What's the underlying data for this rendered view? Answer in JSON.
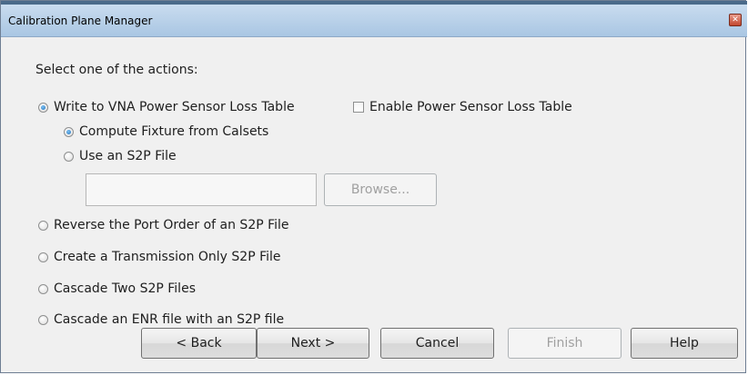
{
  "window": {
    "title": "Calibration Plane Manager",
    "close_glyph": "✕"
  },
  "prompt": "Select one of the actions:",
  "options": {
    "write_vna": {
      "label": "Write to VNA Power Sensor Loss Table",
      "checked": true
    },
    "enable_loss_table": {
      "label": "Enable Power Sensor Loss Table",
      "checked": false
    },
    "compute_fixture": {
      "label": "Compute Fixture from Calsets",
      "checked": true
    },
    "use_s2p": {
      "label": "Use an S2P File",
      "checked": false
    },
    "reverse_port": {
      "label": "Reverse the Port Order of an S2P File",
      "checked": false
    },
    "transmission_only": {
      "label": "Create a Transmission Only S2P File",
      "checked": false
    },
    "cascade_two": {
      "label": "Cascade Two S2P Files",
      "checked": false
    },
    "cascade_enr": {
      "label": "Cascade an ENR file with an S2P file",
      "checked": false
    }
  },
  "s2p_file": {
    "value": "",
    "browse_label": "Browse..."
  },
  "buttons": {
    "back": "< Back",
    "next": "Next >",
    "cancel": "Cancel",
    "finish": "Finish",
    "help": "Help"
  }
}
